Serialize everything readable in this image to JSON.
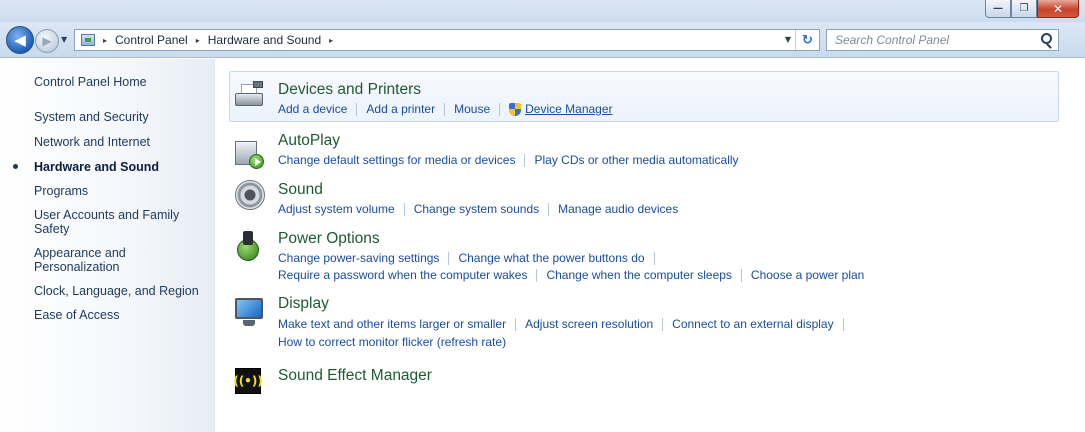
{
  "window": {
    "minimize_glyph": "—",
    "restore_glyph": "❐",
    "close_glyph": "✕"
  },
  "nav": {
    "back_glyph": "◀",
    "forward_glyph": "▶",
    "history_glyph": "▼",
    "breadcrumb": [
      "Control Panel",
      "Hardware and Sound"
    ],
    "crumb_separator": "▸",
    "address_dropdown_glyph": "▼",
    "refresh_glyph": "↻",
    "search_placeholder": "Search Control Panel"
  },
  "sidebar": {
    "home": "Control Panel Home",
    "items": [
      "System and Security",
      "Network and Internet",
      "Hardware and Sound",
      "Programs",
      "User Accounts and Family Safety",
      "Appearance and Personalization",
      "Clock, Language, and Region",
      "Ease of Access"
    ],
    "active_item": "Hardware and Sound"
  },
  "categories": {
    "devices": {
      "icon": "printer-icon",
      "title": "Devices and Printers",
      "tasks": [
        "Add a device",
        "Add a printer",
        "Mouse",
        "Device Manager"
      ]
    },
    "autoplay": {
      "icon": "autoplay-icon",
      "title": "AutoPlay",
      "tasks": [
        "Change default settings for media or devices",
        "Play CDs or other media automatically"
      ]
    },
    "sound": {
      "icon": "speaker-icon",
      "title": "Sound",
      "tasks": [
        "Adjust system volume",
        "Change system sounds",
        "Manage audio devices"
      ]
    },
    "power": {
      "icon": "power-icon",
      "title": "Power Options",
      "tasks_line1": [
        "Change power-saving settings",
        "Change what the power buttons do"
      ],
      "tasks_line2": [
        "Require a password when the computer wakes",
        "Change when the computer sleeps",
        "Choose a power plan"
      ]
    },
    "display": {
      "icon": "monitor-icon",
      "title": "Display",
      "tasks_line1": [
        "Make text and other items larger or smaller",
        "Adjust screen resolution",
        "Connect to an external display"
      ],
      "tasks_line2": [
        "How to correct monitor flicker (refresh rate)"
      ]
    },
    "sem": {
      "icon": "sound-effect-icon",
      "icon_text": "((•))",
      "title": "Sound Effect Manager"
    }
  }
}
